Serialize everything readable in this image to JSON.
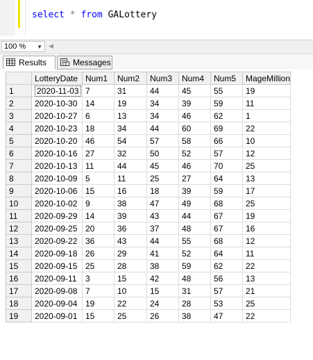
{
  "editor": {
    "keyword_select": "select",
    "operator": "*",
    "keyword_from": "from",
    "table_name": "GALottery"
  },
  "toolbar": {
    "zoom": "100 %"
  },
  "tabs": [
    {
      "label": "Results",
      "icon": "grid-icon"
    },
    {
      "label": "Messages",
      "icon": "messages-icon"
    }
  ],
  "results": {
    "columns": [
      "",
      "LotteryDate",
      "Num1",
      "Num2",
      "Num3",
      "Num4",
      "Num5",
      "MageMillion"
    ],
    "rows": [
      [
        "1",
        "2020-11-03",
        "7",
        "31",
        "44",
        "45",
        "55",
        "19"
      ],
      [
        "2",
        "2020-10-30",
        "14",
        "19",
        "34",
        "39",
        "59",
        "11"
      ],
      [
        "3",
        "2020-10-27",
        "6",
        "13",
        "34",
        "46",
        "62",
        "1"
      ],
      [
        "4",
        "2020-10-23",
        "18",
        "34",
        "44",
        "60",
        "69",
        "22"
      ],
      [
        "5",
        "2020-10-20",
        "46",
        "54",
        "57",
        "58",
        "66",
        "10"
      ],
      [
        "6",
        "2020-10-16",
        "27",
        "32",
        "50",
        "52",
        "57",
        "12"
      ],
      [
        "7",
        "2020-10-13",
        "11",
        "44",
        "45",
        "46",
        "70",
        "25"
      ],
      [
        "8",
        "2020-10-09",
        "5",
        "11",
        "25",
        "27",
        "64",
        "13"
      ],
      [
        "9",
        "2020-10-06",
        "15",
        "16",
        "18",
        "39",
        "59",
        "17"
      ],
      [
        "10",
        "2020-10-02",
        "9",
        "38",
        "47",
        "49",
        "68",
        "25"
      ],
      [
        "11",
        "2020-09-29",
        "14",
        "39",
        "43",
        "44",
        "67",
        "19"
      ],
      [
        "12",
        "2020-09-25",
        "20",
        "36",
        "37",
        "48",
        "67",
        "16"
      ],
      [
        "13",
        "2020-09-22",
        "36",
        "43",
        "44",
        "55",
        "68",
        "12"
      ],
      [
        "14",
        "2020-09-18",
        "26",
        "29",
        "41",
        "52",
        "64",
        "11"
      ],
      [
        "15",
        "2020-09-15",
        "25",
        "28",
        "38",
        "59",
        "62",
        "22"
      ],
      [
        "16",
        "2020-09-11",
        "3",
        "15",
        "42",
        "48",
        "56",
        "13"
      ],
      [
        "17",
        "2020-09-08",
        "7",
        "10",
        "15",
        "31",
        "57",
        "21"
      ],
      [
        "18",
        "2020-09-04",
        "19",
        "22",
        "24",
        "28",
        "53",
        "25"
      ],
      [
        "19",
        "2020-09-01",
        "15",
        "25",
        "26",
        "38",
        "47",
        "22"
      ]
    ]
  }
}
